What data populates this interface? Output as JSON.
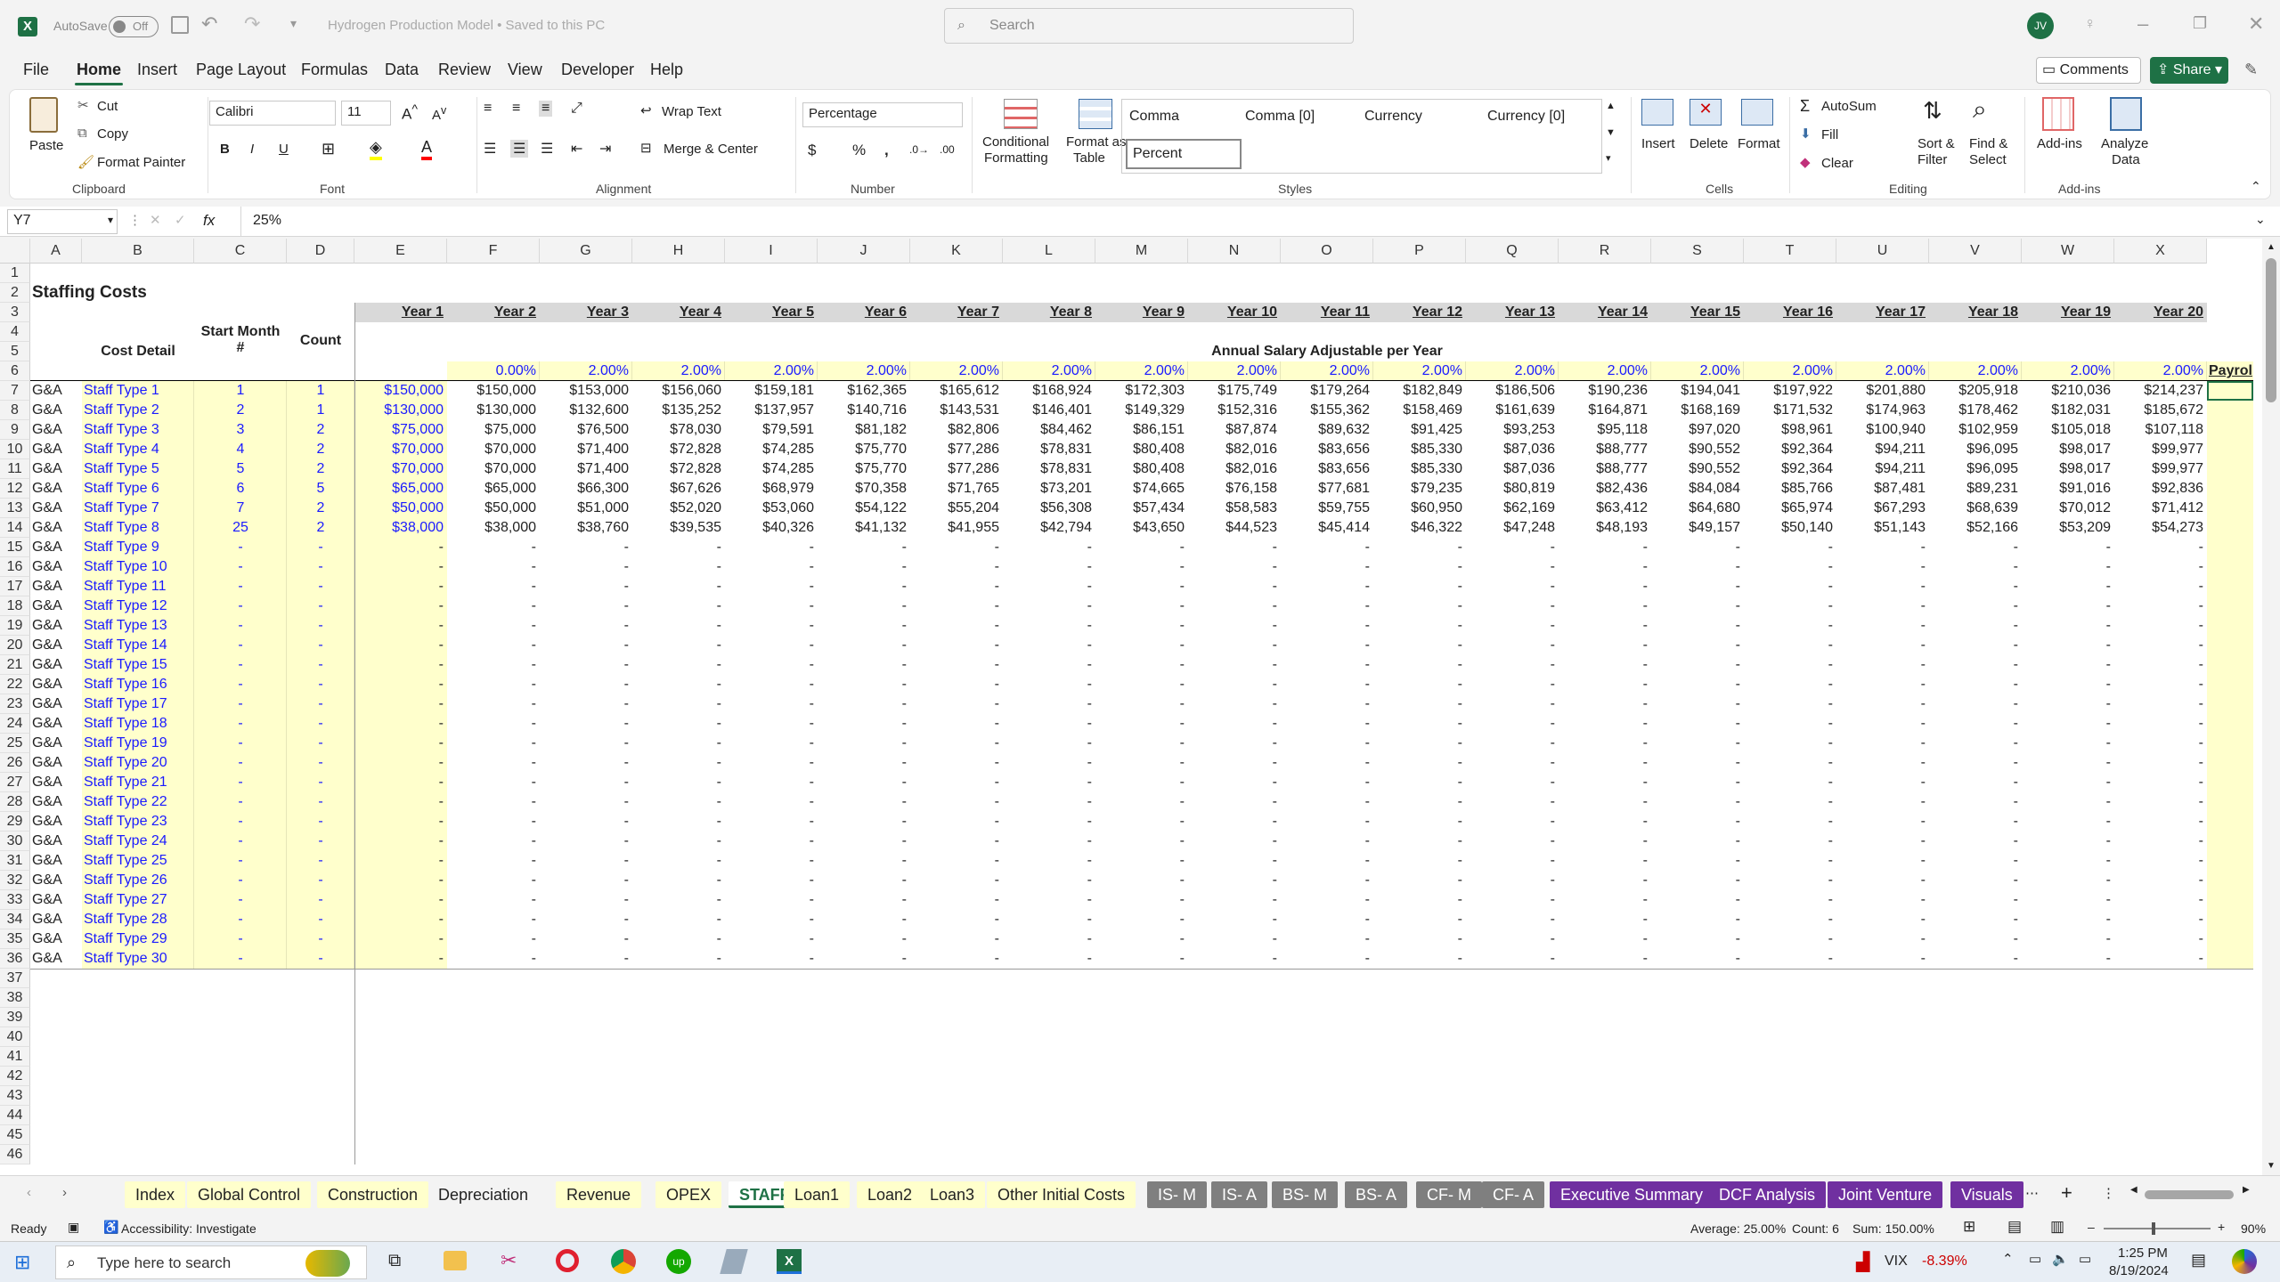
{
  "titlebar": {
    "autosave": "AutoSave",
    "autosave_state": "Off",
    "doc_title": "Hydrogen Production Model • Saved to this PC",
    "search_placeholder": "Search",
    "user_initials": "JV"
  },
  "menu": [
    "File",
    "Home",
    "Insert",
    "Page Layout",
    "Formulas",
    "Data",
    "Review",
    "View",
    "Developer",
    "Help"
  ],
  "menu_right": {
    "comments": "Comments",
    "share": "Share"
  },
  "ribbon": {
    "clipboard": {
      "paste": "Paste",
      "cut": "Cut",
      "copy": "Copy",
      "format_painter": "Format Painter",
      "label": "Clipboard"
    },
    "font": {
      "name": "Calibri",
      "size": "11",
      "label": "Font"
    },
    "alignment": {
      "wrap": "Wrap Text",
      "merge": "Merge & Center",
      "label": "Alignment"
    },
    "number": {
      "format": "Percentage",
      "label": "Number"
    },
    "styles": {
      "cond1": "Conditional",
      "cond2": "Formatting",
      "fmt1": "Format as",
      "fmt2": "Table",
      "s1": "Comma",
      "s2": "Comma [0]",
      "s3": "Currency",
      "s4": "Currency [0]",
      "s5": "Percent",
      "label": "Styles"
    },
    "cells": {
      "insert": "Insert",
      "delete": "Delete",
      "format": "Format",
      "label": "Cells"
    },
    "editing": {
      "autosum": "AutoSum",
      "fill": "Fill",
      "clear": "Clear",
      "sort1": "Sort &",
      "sort2": "Filter",
      "find1": "Find &",
      "find2": "Select",
      "label": "Editing"
    },
    "addins": {
      "addins": "Add-ins",
      "analyze1": "Analyze",
      "analyze2": "Data",
      "label": "Add-ins"
    }
  },
  "formula": {
    "namebox": "Y7",
    "fx": "fx",
    "value": "25%"
  },
  "columns": [
    "A",
    "B",
    "C",
    "D",
    "E",
    "F",
    "G",
    "H",
    "I",
    "J",
    "K",
    "L",
    "M",
    "N",
    "O",
    "P",
    "Q",
    "R",
    "S",
    "T",
    "U",
    "V",
    "W",
    "X"
  ],
  "sheet": {
    "title": "Staffing Costs",
    "years": [
      "Year 1",
      "Year 2",
      "Year 3",
      "Year 4",
      "Year 5",
      "Year 6",
      "Year 7",
      "Year 8",
      "Year 9",
      "Year 10",
      "Year 11",
      "Year 12",
      "Year 13",
      "Year 14",
      "Year 15",
      "Year 16",
      "Year 17",
      "Year 18",
      "Year 19",
      "Year 20"
    ],
    "hdr_cost_detail": "Cost Detail",
    "hdr_start1": "Start Month",
    "hdr_start2": "#",
    "hdr_count": "Count",
    "hdr_annual": "Annual Salary Adjustable per Year",
    "hdr_payroll": "Payrol",
    "pct": [
      "0.00%",
      "2.00%",
      "2.00%",
      "2.00%",
      "2.00%",
      "2.00%",
      "2.00%",
      "2.00%",
      "2.00%",
      "2.00%",
      "2.00%",
      "2.00%",
      "2.00%",
      "2.00%",
      "2.00%",
      "2.00%",
      "2.00%",
      "2.00%",
      "2.00%"
    ],
    "rows": [
      {
        "a": "G&A",
        "b": "Staff Type 1",
        "c": "1",
        "d": "1",
        "vals": [
          "$150,000",
          "$150,000",
          "$153,000",
          "$156,060",
          "$159,181",
          "$162,365",
          "$165,612",
          "$168,924",
          "$172,303",
          "$175,749",
          "$179,264",
          "$182,849",
          "$186,506",
          "$190,236",
          "$194,041",
          "$197,922",
          "$201,880",
          "$205,918",
          "$210,036",
          "$214,237"
        ]
      },
      {
        "a": "G&A",
        "b": "Staff Type 2",
        "c": "2",
        "d": "1",
        "vals": [
          "$130,000",
          "$130,000",
          "$132,600",
          "$135,252",
          "$137,957",
          "$140,716",
          "$143,531",
          "$146,401",
          "$149,329",
          "$152,316",
          "$155,362",
          "$158,469",
          "$161,639",
          "$164,871",
          "$168,169",
          "$171,532",
          "$174,963",
          "$178,462",
          "$182,031",
          "$185,672"
        ]
      },
      {
        "a": "G&A",
        "b": "Staff Type 3",
        "c": "3",
        "d": "2",
        "vals": [
          "$75,000",
          "$75,000",
          "$76,500",
          "$78,030",
          "$79,591",
          "$81,182",
          "$82,806",
          "$84,462",
          "$86,151",
          "$87,874",
          "$89,632",
          "$91,425",
          "$93,253",
          "$95,118",
          "$97,020",
          "$98,961",
          "$100,940",
          "$102,959",
          "$105,018",
          "$107,118"
        ]
      },
      {
        "a": "G&A",
        "b": "Staff Type 4",
        "c": "4",
        "d": "2",
        "vals": [
          "$70,000",
          "$70,000",
          "$71,400",
          "$72,828",
          "$74,285",
          "$75,770",
          "$77,286",
          "$78,831",
          "$80,408",
          "$82,016",
          "$83,656",
          "$85,330",
          "$87,036",
          "$88,777",
          "$90,552",
          "$92,364",
          "$94,211",
          "$96,095",
          "$98,017",
          "$99,977"
        ]
      },
      {
        "a": "G&A",
        "b": "Staff Type 5",
        "c": "5",
        "d": "2",
        "vals": [
          "$70,000",
          "$70,000",
          "$71,400",
          "$72,828",
          "$74,285",
          "$75,770",
          "$77,286",
          "$78,831",
          "$80,408",
          "$82,016",
          "$83,656",
          "$85,330",
          "$87,036",
          "$88,777",
          "$90,552",
          "$92,364",
          "$94,211",
          "$96,095",
          "$98,017",
          "$99,977"
        ]
      },
      {
        "a": "G&A",
        "b": "Staff Type 6",
        "c": "6",
        "d": "5",
        "vals": [
          "$65,000",
          "$65,000",
          "$66,300",
          "$67,626",
          "$68,979",
          "$70,358",
          "$71,765",
          "$73,201",
          "$74,665",
          "$76,158",
          "$77,681",
          "$79,235",
          "$80,819",
          "$82,436",
          "$84,084",
          "$85,766",
          "$87,481",
          "$89,231",
          "$91,016",
          "$92,836"
        ]
      },
      {
        "a": "G&A",
        "b": "Staff Type 7",
        "c": "7",
        "d": "2",
        "vals": [
          "$50,000",
          "$50,000",
          "$51,000",
          "$52,020",
          "$53,060",
          "$54,122",
          "$55,204",
          "$56,308",
          "$57,434",
          "$58,583",
          "$59,755",
          "$60,950",
          "$62,169",
          "$63,412",
          "$64,680",
          "$65,974",
          "$67,293",
          "$68,639",
          "$70,012",
          "$71,412"
        ]
      },
      {
        "a": "G&A",
        "b": "Staff Type 8",
        "c": "25",
        "d": "2",
        "vals": [
          "$38,000",
          "$38,000",
          "$38,760",
          "$39,535",
          "$40,326",
          "$41,132",
          "$41,955",
          "$42,794",
          "$43,650",
          "$44,523",
          "$45,414",
          "$46,322",
          "$47,248",
          "$48,193",
          "$49,157",
          "$50,140",
          "$51,143",
          "$52,166",
          "$53,209",
          "$54,273"
        ]
      }
    ],
    "empty_prefix": "Staff Type ",
    "dash": "-",
    "empty_label": "G&A"
  },
  "tabs": [
    "Index",
    "Global Control",
    "Construction",
    "Depreciation",
    "Revenue",
    "OPEX",
    "STAFF",
    "Loan1",
    "Loan2",
    "Loan3",
    "Other Initial Costs",
    "IS- M",
    "IS- A",
    "BS- M",
    "BS- A",
    "CF- M",
    "CF- A",
    "Executive Summary",
    "DCF Analysis",
    "Joint Venture",
    "Visuals"
  ],
  "status": {
    "ready": "Ready",
    "accessibility": "Accessibility: Investigate",
    "average": "Average: 25.00%",
    "count": "Count: 6",
    "sum": "Sum: 150.00%",
    "zoom": "90%"
  },
  "taskbar": {
    "search": "Type here to search",
    "vix": "VIX",
    "vix_change": "-8.39%",
    "time": "1:25 PM",
    "date": "8/19/2024"
  }
}
